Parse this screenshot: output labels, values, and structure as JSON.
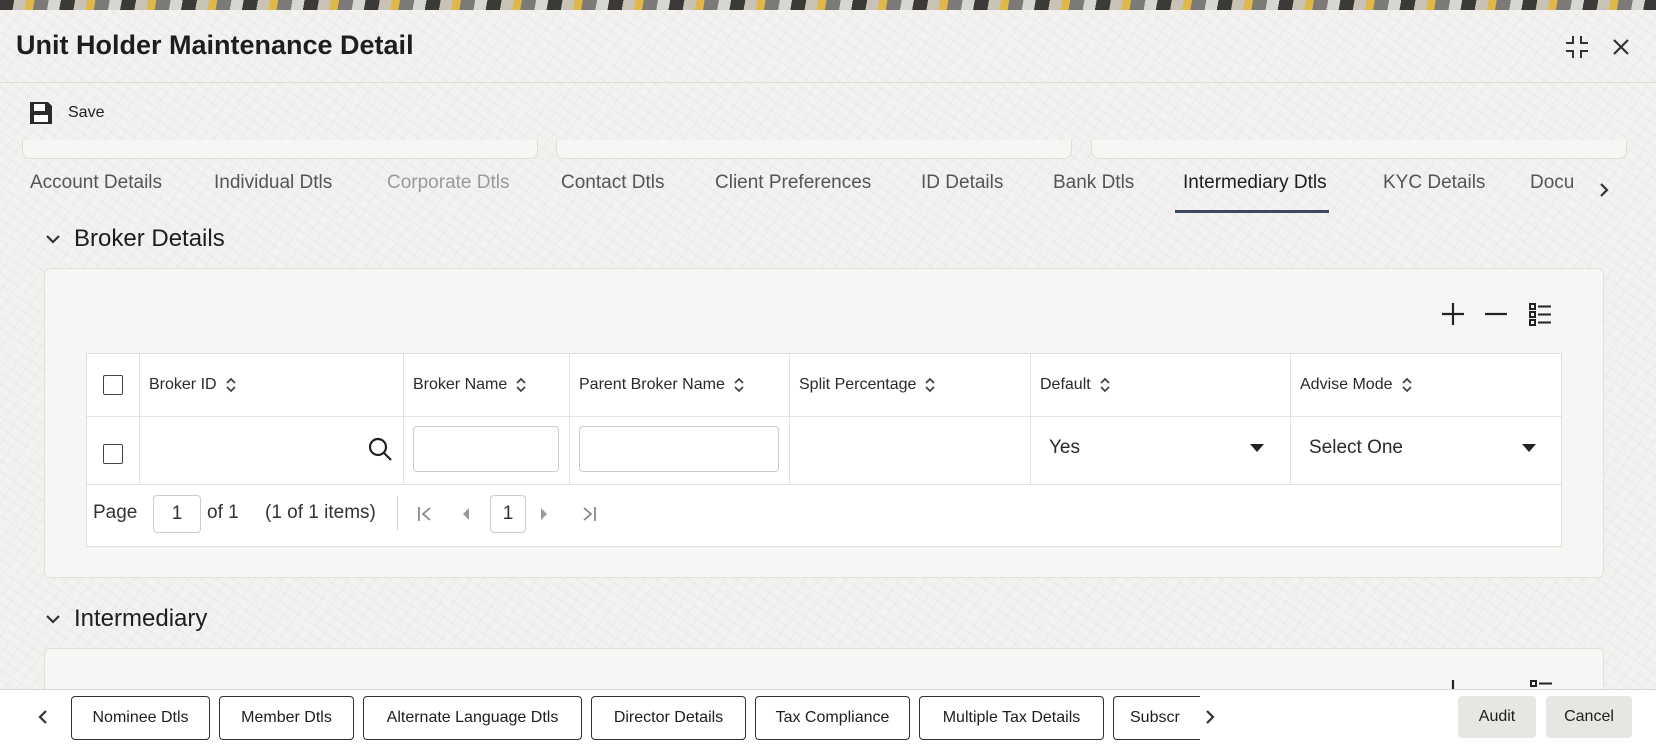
{
  "window": {
    "title": "Unit Holder Maintenance Detail"
  },
  "toolbar": {
    "save_label": "Save"
  },
  "tabs": [
    {
      "label": "Account Details",
      "state": "normal"
    },
    {
      "label": "Individual Dtls",
      "state": "normal"
    },
    {
      "label": "Corporate Dtls",
      "state": "disabled"
    },
    {
      "label": "Contact Dtls",
      "state": "normal"
    },
    {
      "label": "Client Preferences",
      "state": "normal"
    },
    {
      "label": "ID Details",
      "state": "normal"
    },
    {
      "label": "Bank Dtls",
      "state": "normal"
    },
    {
      "label": "Intermediary Dtls",
      "state": "active"
    },
    {
      "label": "KYC Details",
      "state": "normal"
    },
    {
      "label": "Docu",
      "state": "normal"
    }
  ],
  "broker": {
    "section_title": "Broker Details",
    "columns": [
      "Broker ID",
      "Broker Name",
      "Parent Broker Name",
      "Split Percentage",
      "Default",
      "Advise Mode"
    ],
    "row": {
      "broker_id": "",
      "broker_name": "",
      "parent_broker_name": "",
      "split_percentage": "",
      "default": "Yes",
      "advise_mode": "Select One"
    },
    "pager": {
      "page_label": "Page",
      "page": "1",
      "of_label": "of 1",
      "items_label": "(1 of 1 items)",
      "current": "1"
    }
  },
  "intermediary": {
    "section_title": "Intermediary"
  },
  "footer": {
    "buttons": [
      "Nominee Dtls",
      "Member Dtls",
      "Alternate Language Dtls",
      "Director Details",
      "Tax Compliance",
      "Multiple Tax Details",
      "Subscr"
    ],
    "audit_label": "Audit",
    "cancel_label": "Cancel"
  },
  "icons": [
    "save-icon",
    "minimize-icon",
    "close-icon",
    "chevron-down-icon",
    "chevron-right-icon",
    "add-icon",
    "remove-icon",
    "column-list-icon",
    "sort-icon",
    "search-icon",
    "dropdown-arrow-icon",
    "first-page-icon",
    "prev-page-icon",
    "next-page-icon",
    "last-page-icon",
    "chevron-left-icon"
  ]
}
